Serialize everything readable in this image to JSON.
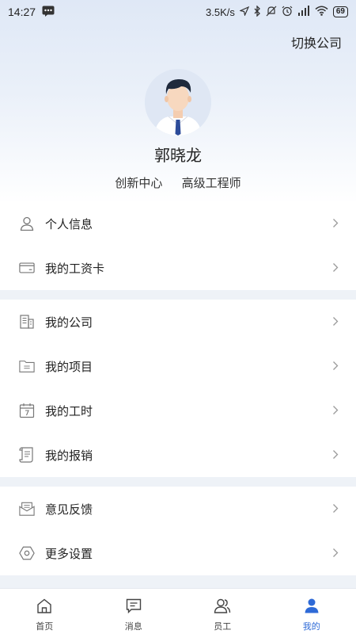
{
  "status_bar": {
    "time": "14:27",
    "speed": "3.5K/s",
    "battery": "69"
  },
  "header": {
    "switch_company": "切换公司",
    "name": "郭晓龙",
    "department": "创新中心",
    "title": "高级工程师"
  },
  "menu": {
    "personal_info": "个人信息",
    "salary_card": "我的工资卡",
    "my_company": "我的公司",
    "my_project": "我的项目",
    "my_hours": "我的工时",
    "my_reimbursement": "我的报销",
    "feedback": "意见反馈",
    "more_settings": "更多设置"
  },
  "tabs": {
    "home": "首页",
    "messages": "消息",
    "staff": "员工",
    "mine": "我的"
  },
  "colors": {
    "accent": "#2e6ad7",
    "icon_gray": "#777777"
  }
}
